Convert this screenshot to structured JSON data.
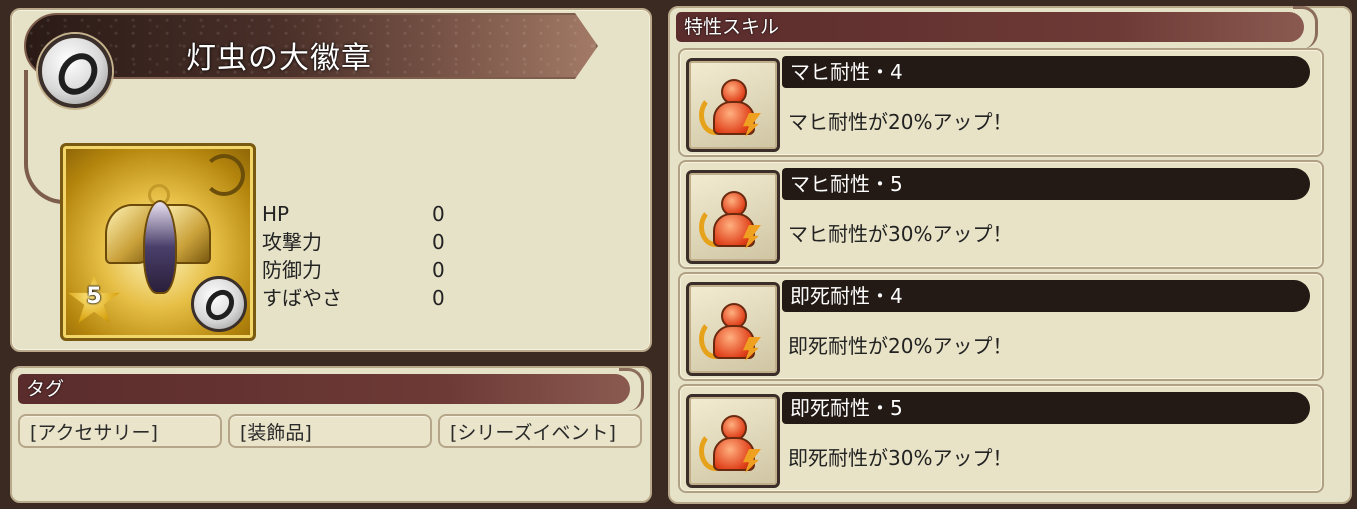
{
  "item": {
    "name": "灯虫の大徽章",
    "rarity": "5",
    "type_icon": "ring-icon"
  },
  "stats": [
    {
      "label": "HP",
      "value": "0"
    },
    {
      "label": "攻撃力",
      "value": "0"
    },
    {
      "label": "防御力",
      "value": "0"
    },
    {
      "label": "すばやさ",
      "value": "0"
    }
  ],
  "tags": {
    "header": "タグ",
    "items": [
      "[アクセサリー]",
      "[装飾品]",
      "[シリーズイベント]"
    ]
  },
  "skills": {
    "header": "特性スキル",
    "items": [
      {
        "title": "マヒ耐性・4",
        "desc": "マヒ耐性が20%アップ！",
        "icon": "resistance-icon"
      },
      {
        "title": "マヒ耐性・5",
        "desc": "マヒ耐性が30%アップ！",
        "icon": "resistance-icon"
      },
      {
        "title": "即死耐性・4",
        "desc": "即死耐性が20%アップ！",
        "icon": "resistance-icon"
      },
      {
        "title": "即死耐性・5",
        "desc": "即死耐性が30%アップ！",
        "icon": "resistance-icon"
      }
    ]
  },
  "colors": {
    "panel_bg": "#e6e2c8",
    "header_bar": "#5a2c2c",
    "skill_title_bar": "#231a15",
    "text": "#222222"
  }
}
